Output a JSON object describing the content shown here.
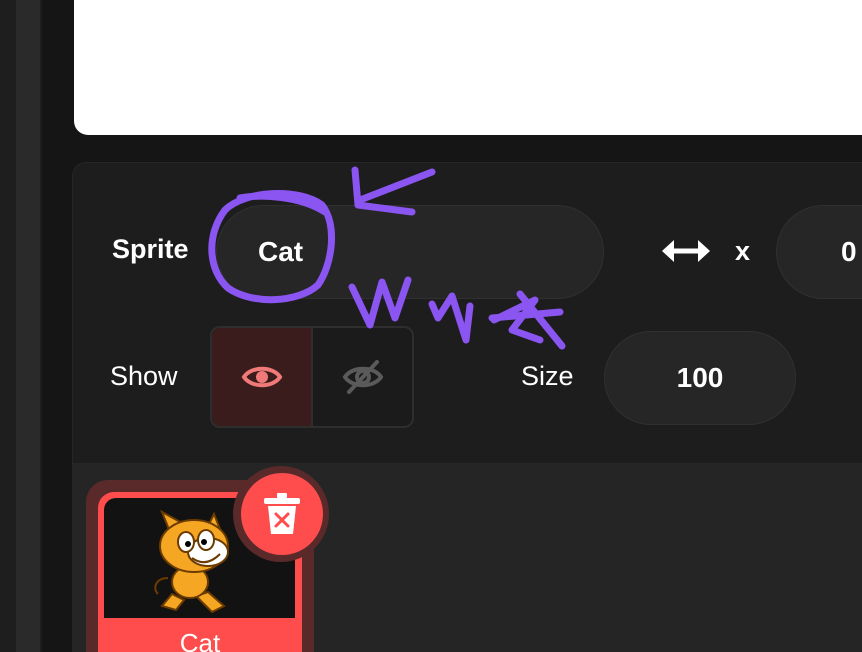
{
  "sprite_info": {
    "sprite_label": "Sprite",
    "sprite_name": "Cat",
    "x_label": "x",
    "x_value": "0",
    "show_label": "Show",
    "size_label": "Size",
    "size_value": "100",
    "visibility": "shown"
  },
  "sprite_list": {
    "items": [
      {
        "name": "Cat",
        "selected": true
      }
    ]
  },
  "annotation": {
    "handwritten_text": "What"
  },
  "colors": {
    "accent": "#ff4d4d",
    "annotation": "#8a55f0",
    "eye_active": "#f07a7a"
  },
  "icons": [
    "left-right-arrows-icon",
    "eye-icon",
    "eye-slash-icon",
    "trash-icon",
    "cat-icon"
  ]
}
